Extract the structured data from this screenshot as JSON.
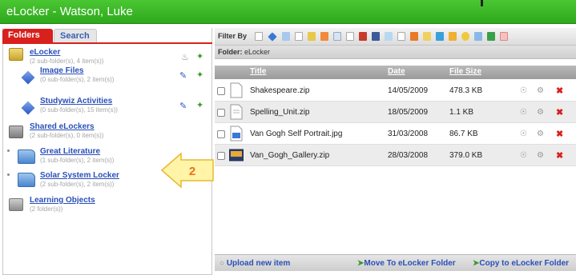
{
  "window": {
    "title": "eLocker - Watson, Luke"
  },
  "tabs": [
    {
      "label": "Folders"
    },
    {
      "label": "Search"
    }
  ],
  "tree": [
    {
      "label": "eLocker",
      "sub": "(2 sub-folder(s), 4 item(s))"
    },
    {
      "label": "Image Files",
      "sub": "(0 sub-folder(s), 2 item(s))"
    },
    {
      "label": "Studywiz Activities",
      "sub": "(0 sub-folder(s), 15 item(s))"
    },
    {
      "label": "Shared eLockers",
      "sub": "(2 sub-folder(s), 0 item(s))"
    },
    {
      "label": "Great Literature",
      "sub": "(1 sub-folder(s), 2 item(s))"
    },
    {
      "label": "Solar System Locker",
      "sub": "(2 sub-folder(s), 2 item(s))"
    },
    {
      "label": "Learning Objects",
      "sub": "(2 folder(s))"
    }
  ],
  "callout": {
    "number": "2",
    "color": "#fff4a8",
    "text_color": "#e8731c"
  },
  "filter": {
    "label": "Filter By"
  },
  "folder_bar": {
    "label": "Folder:",
    "name": "eLocker"
  },
  "table": {
    "headers": {
      "title": "Title",
      "date": "Date",
      "size": "File Size"
    },
    "rows": [
      {
        "title": "Shakespeare.zip",
        "date": "14/05/2009",
        "size": "478.3 KB",
        "icon": "zip-file-icon"
      },
      {
        "title": "Spelling_Unit.zip",
        "date": "18/05/2009",
        "size": "1.1 KB",
        "icon": "zip-file-icon"
      },
      {
        "title": "Van Gogh Self Portrait.jpg",
        "date": "31/03/2008",
        "size": "86.7 KB",
        "icon": "image-file-icon"
      },
      {
        "title": "Van_Gogh_Gallery.zip",
        "date": "28/03/2008",
        "size": "379.0 KB",
        "icon": "gallery-file-icon"
      }
    ]
  },
  "bottom": {
    "upload": "Upload new item",
    "move": "Move To eLocker Folder",
    "copy": "Copy to eLocker Folder"
  },
  "colors": {
    "title_green": "#2ea81c",
    "tab_red": "#d8201c",
    "link_blue": "#2a4fb8"
  }
}
